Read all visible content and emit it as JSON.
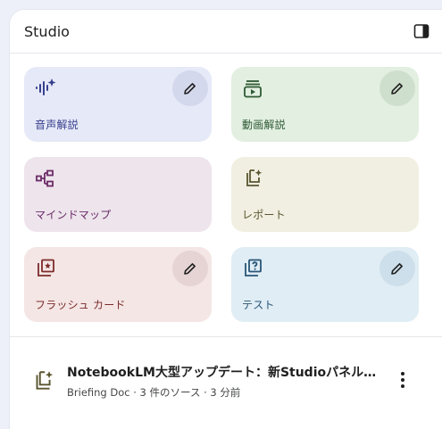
{
  "studio": {
    "title": "Studio",
    "cards": [
      {
        "label": "音声解説",
        "icon": "audio-spark-icon",
        "has_edit": true
      },
      {
        "label": "動画解説",
        "icon": "video-play-icon",
        "has_edit": true
      },
      {
        "label": "マインドマップ",
        "icon": "mind-map-icon",
        "has_edit": false
      },
      {
        "label": "レポート",
        "icon": "report-spark-icon",
        "has_edit": false
      },
      {
        "label": "フラッシュ カード",
        "icon": "flashcards-icon",
        "has_edit": true
      },
      {
        "label": "テスト",
        "icon": "quiz-icon",
        "has_edit": true
      }
    ],
    "note": {
      "title": "NotebookLM大型アップデート：新Studioパネルと動画解説機能",
      "subtitle": "Briefing Doc · 3 件のソース · 3 分前",
      "icon": "report-spark-icon"
    }
  },
  "colors": {
    "page_bg": "#eef0f9",
    "audio": "#e6e9f7",
    "video": "#e2efe1",
    "mind_map": "#ede4ec",
    "report": "#f0efe1",
    "flashcards": "#f4e6e5",
    "test": "#e0edf5"
  }
}
